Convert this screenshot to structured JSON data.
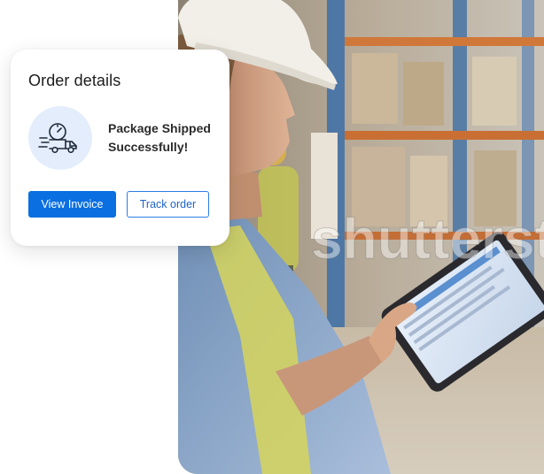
{
  "order_card": {
    "title": "Order details",
    "status_icon": "delivery-truck-icon",
    "status_line_1": "Package Shipped",
    "status_line_2": "Successfully!",
    "view_invoice_label": "View Invoice",
    "track_order_label": "Track order"
  },
  "photo": {
    "watermark": "shutterstock"
  },
  "colors": {
    "primary": "#0a6fe1",
    "icon_bg": "#e3edfb",
    "outline_border": "#2c7be5"
  }
}
